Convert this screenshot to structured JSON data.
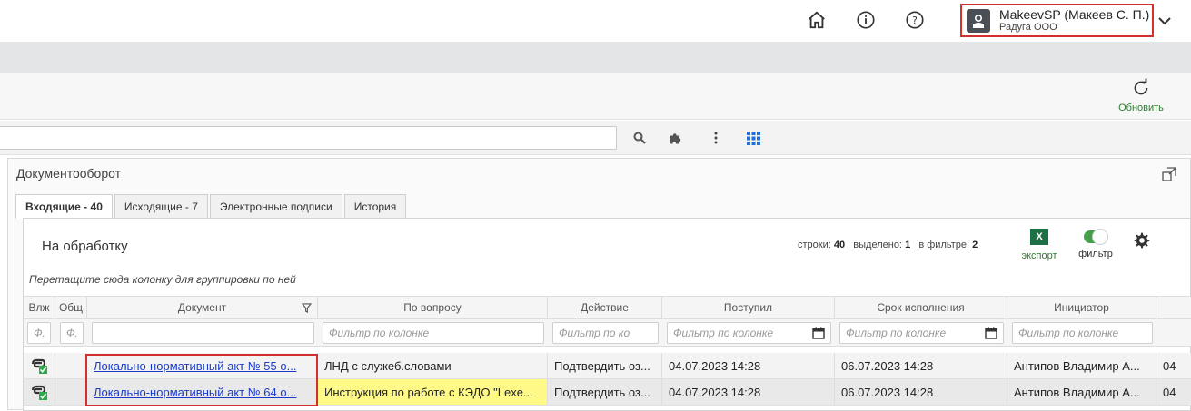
{
  "header": {
    "user_name": "MakeevSP (Макеев С. П.)",
    "user_org": "Радуга ООО",
    "icons": [
      "home-icon",
      "info-icon",
      "help-icon",
      "chevron-down-icon"
    ]
  },
  "toolbar": {
    "refresh_label": "Обновить"
  },
  "search": {
    "value": ""
  },
  "panel": {
    "title": "Документооборот"
  },
  "tabs": [
    {
      "label": "Входящие - 40",
      "active": true
    },
    {
      "label": "Исходящие - 7",
      "active": false
    },
    {
      "label": "Электронные подписи",
      "active": false
    },
    {
      "label": "История",
      "active": false
    }
  ],
  "grid_panel": {
    "title": "На обработку",
    "rows_label": "строки:",
    "rows_value": "40",
    "selected_label": "выделено:",
    "selected_value": "1",
    "filtered_label": "в фильтре:",
    "filtered_value": "2",
    "export_label": "экспорт",
    "export_icon_text": "X",
    "filter_label": "фильтр",
    "group_hint": "Перетащите сюда колонку для группировки по ней"
  },
  "columns": [
    "Вложения",
    "Общий",
    "Документ",
    "По вопросу",
    "Действие",
    "Поступил",
    "Срок исполнения",
    "Инициатор",
    ""
  ],
  "column_headers_visible": [
    "Влж",
    "Общ",
    "Документ",
    "По вопросу",
    "Действие",
    "Поступил",
    "Срок исполнения",
    "Инициатор",
    ""
  ],
  "filter_placeholders": {
    "short": "Ф.",
    "generic": "Фильтр по колонке",
    "action": "Фильтр по ко"
  },
  "rows": [
    {
      "document": "Локально-нормативный акт № 55 о...",
      "topic": "ЛНД с служеб.словами",
      "action": "Подтвердить оз...",
      "received": "04.07.2023 14:28",
      "deadline": "06.07.2023 14:28",
      "initiator": "Антипов Владимир А...",
      "extra": "04",
      "highlighted_topic": false
    },
    {
      "document": "Локально-нормативный акт № 64 о...",
      "topic": "Инструкция по работе с КЭДО \"Lexe...",
      "action": "Подтвердить оз...",
      "received": "04.07.2023 14:28",
      "deadline": "06.07.2023 14:28",
      "initiator": "Антипов Владимир А...",
      "extra": "04",
      "highlighted_topic": true
    }
  ],
  "colors": {
    "accent_green": "#2e7d32",
    "highlight_red": "#d32f2f",
    "link_blue": "#1a3cc9",
    "row_highlight_yellow": "#fff987"
  }
}
